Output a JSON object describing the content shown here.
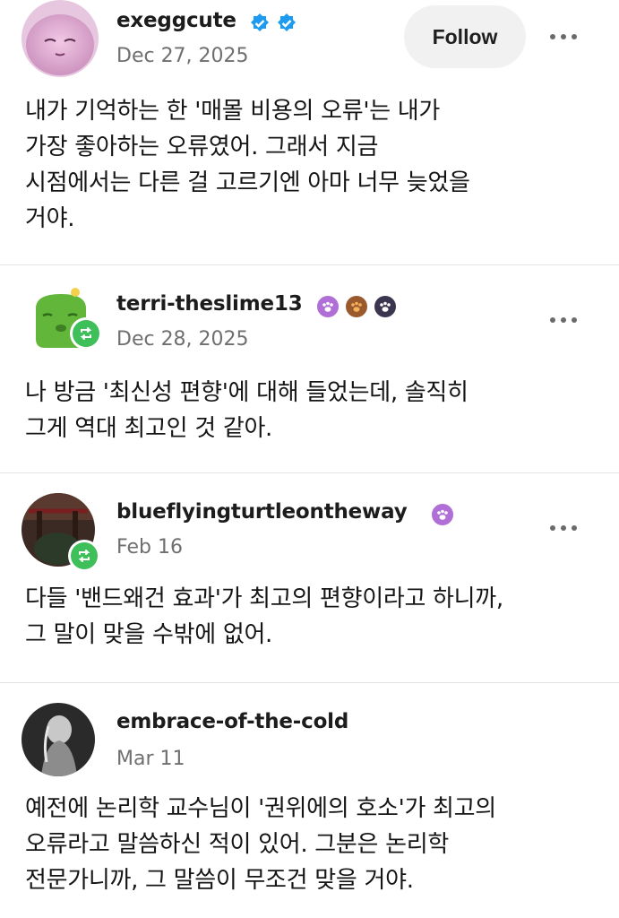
{
  "posts": [
    {
      "username": "exeggcute",
      "date": "Dec 27, 2025",
      "follow_label": "Follow",
      "badges": [
        "verified-badge",
        "verified-badge"
      ],
      "lines": [
        "내가 기억하는 한 '매몰 비용의 오류'는 내가",
        "가장 좋아하는 오류였어. 그래서 지금",
        "시점에서는 다른 걸 고르기엔 아마 너무 늦었을",
        "거야."
      ]
    },
    {
      "username": "terri-theslime13",
      "date": "Dec 28, 2025",
      "badges": [
        "paw-badge-purple",
        "paw-badge-brown",
        "paw-badge-dark"
      ],
      "lines": [
        "나 방금 '최신성 편향'에 대해 들었는데, 솔직히",
        "그게 역대 최고인 것 같아."
      ]
    },
    {
      "username": "blueflyingturtleontheway",
      "date": "Feb 16",
      "badges": [
        "paw-badge-purple"
      ],
      "lines": [
        "다들 '밴드왜건 효과'가 최고의 편향이라고 하니까,",
        "그 말이 맞을 수밖에 없어."
      ]
    },
    {
      "username": "embrace-of-the-cold",
      "date": "Mar 11",
      "lines": [
        "예전에 논리학 교수님이 '권위에의 호소'가 최고의",
        "오류라고 말씀하신 적이 있어. 그분은 논리학",
        "전문가니까, 그 말씀이 무조건 맞을 거야."
      ]
    }
  ],
  "colors": {
    "verified": "#1d9bf0",
    "reblog": "#3fbf5a",
    "paw_purple": "#b06fd6",
    "paw_brown": "#9a5a2e",
    "paw_dark": "#3b3550"
  }
}
